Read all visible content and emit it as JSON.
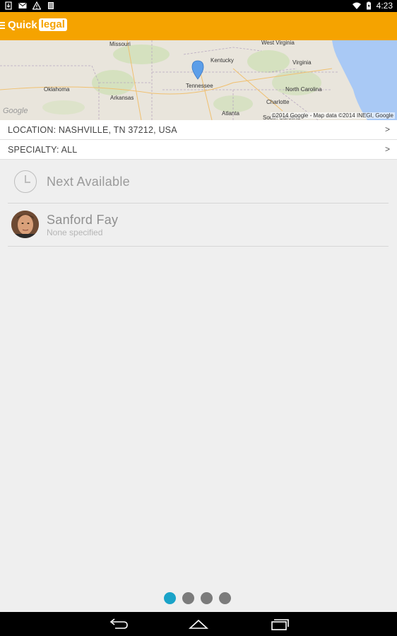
{
  "status_bar": {
    "time": "4:23",
    "icons": [
      "download-icon",
      "mail-icon",
      "warning-icon",
      "sim-icon",
      "wifi-icon",
      "battery-icon"
    ]
  },
  "app_bar": {
    "logo_part1": "Quick",
    "logo_part2": "legal",
    "accent_color": "#f5a300"
  },
  "map": {
    "labels": {
      "missouri": "Missouri",
      "kentucky": "Kentucky",
      "west_virginia": "West Virginia",
      "virginia": "Virginia",
      "oklahoma": "Oklahoma",
      "arkansas": "Arkansas",
      "tennessee": "Tennessee",
      "north_carolina": "North Carolina",
      "charlotte": "Charlotte",
      "atlanta": "Atlanta",
      "south_carolina": "South Carolina"
    },
    "watermark": "Google",
    "copyright": "©2014 Google - Map data ©2014 INEGI, Google"
  },
  "filters": {
    "location": "LOCATION: NASHVILLE, TN 37212, USA",
    "specialty": "SPECIALTY: ALL",
    "chevron": ">"
  },
  "list": {
    "next_available": "Next Available",
    "lawyer": {
      "name": "Sanford Fay",
      "specialty": "None specified"
    }
  },
  "pager": {
    "count": 4,
    "active_index": 0,
    "active_color": "#1aa3c8"
  },
  "nav_bar": {
    "icons": [
      "back-icon",
      "home-icon",
      "recent-apps-icon"
    ]
  }
}
